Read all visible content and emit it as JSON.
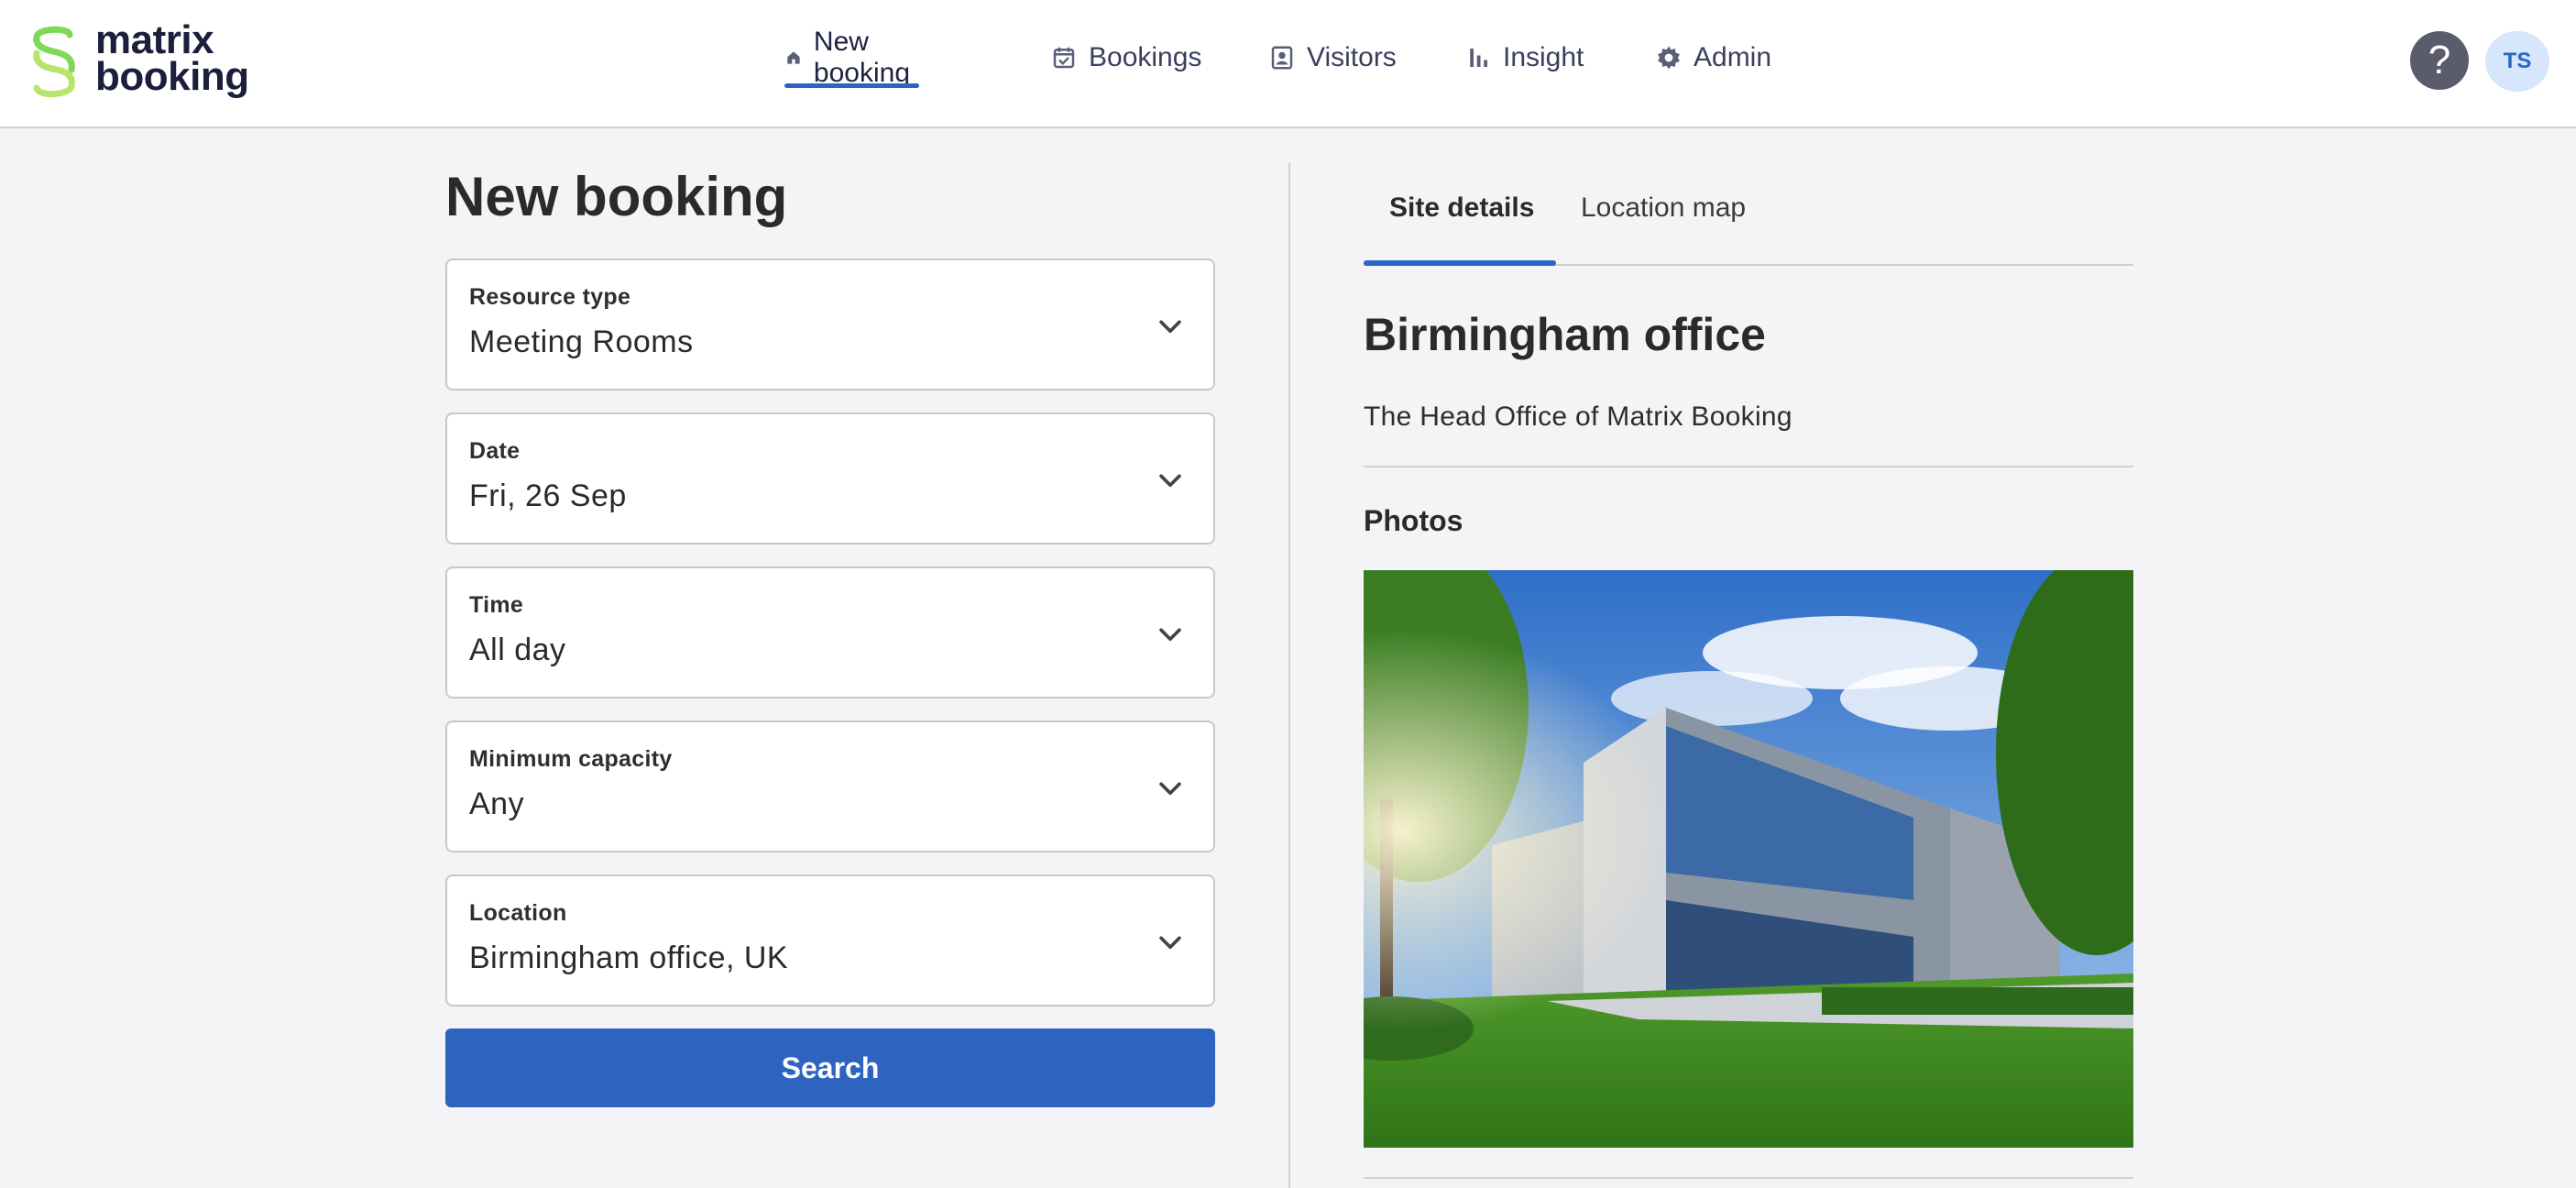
{
  "app": {
    "logo_line1": "matrix",
    "logo_line2": "booking",
    "brand_colors": {
      "logo_green": "#7ed957",
      "logo_navy": "#1b1f3b",
      "accent_blue": "#2a64c4"
    }
  },
  "nav": {
    "items": [
      {
        "label": "New booking",
        "icon": "home-icon",
        "active": true
      },
      {
        "label": "Bookings",
        "icon": "calendar-icon",
        "active": false
      },
      {
        "label": "Visitors",
        "icon": "visitor-badge-icon",
        "active": false
      },
      {
        "label": "Insight",
        "icon": "bar-chart-icon",
        "active": false
      },
      {
        "label": "Admin",
        "icon": "gear-icon",
        "active": false
      }
    ]
  },
  "header_actions": {
    "help_label": "?",
    "avatar_initials": "TS"
  },
  "form": {
    "title": "New booking",
    "fields": [
      {
        "label": "Resource type",
        "value": "Meeting Rooms"
      },
      {
        "label": "Date",
        "value": "Fri, 26 Sep"
      },
      {
        "label": "Time",
        "value": "All day"
      },
      {
        "label": "Minimum capacity",
        "value": "Any"
      },
      {
        "label": "Location",
        "value": "Birmingham office, UK"
      }
    ],
    "search_label": "Search"
  },
  "site_panel": {
    "tabs": [
      {
        "label": "Site details",
        "active": true
      },
      {
        "label": "Location map",
        "active": false
      }
    ],
    "site_name": "Birmingham office",
    "description": "The Head Office of Matrix Booking",
    "photos_heading": "Photos"
  }
}
